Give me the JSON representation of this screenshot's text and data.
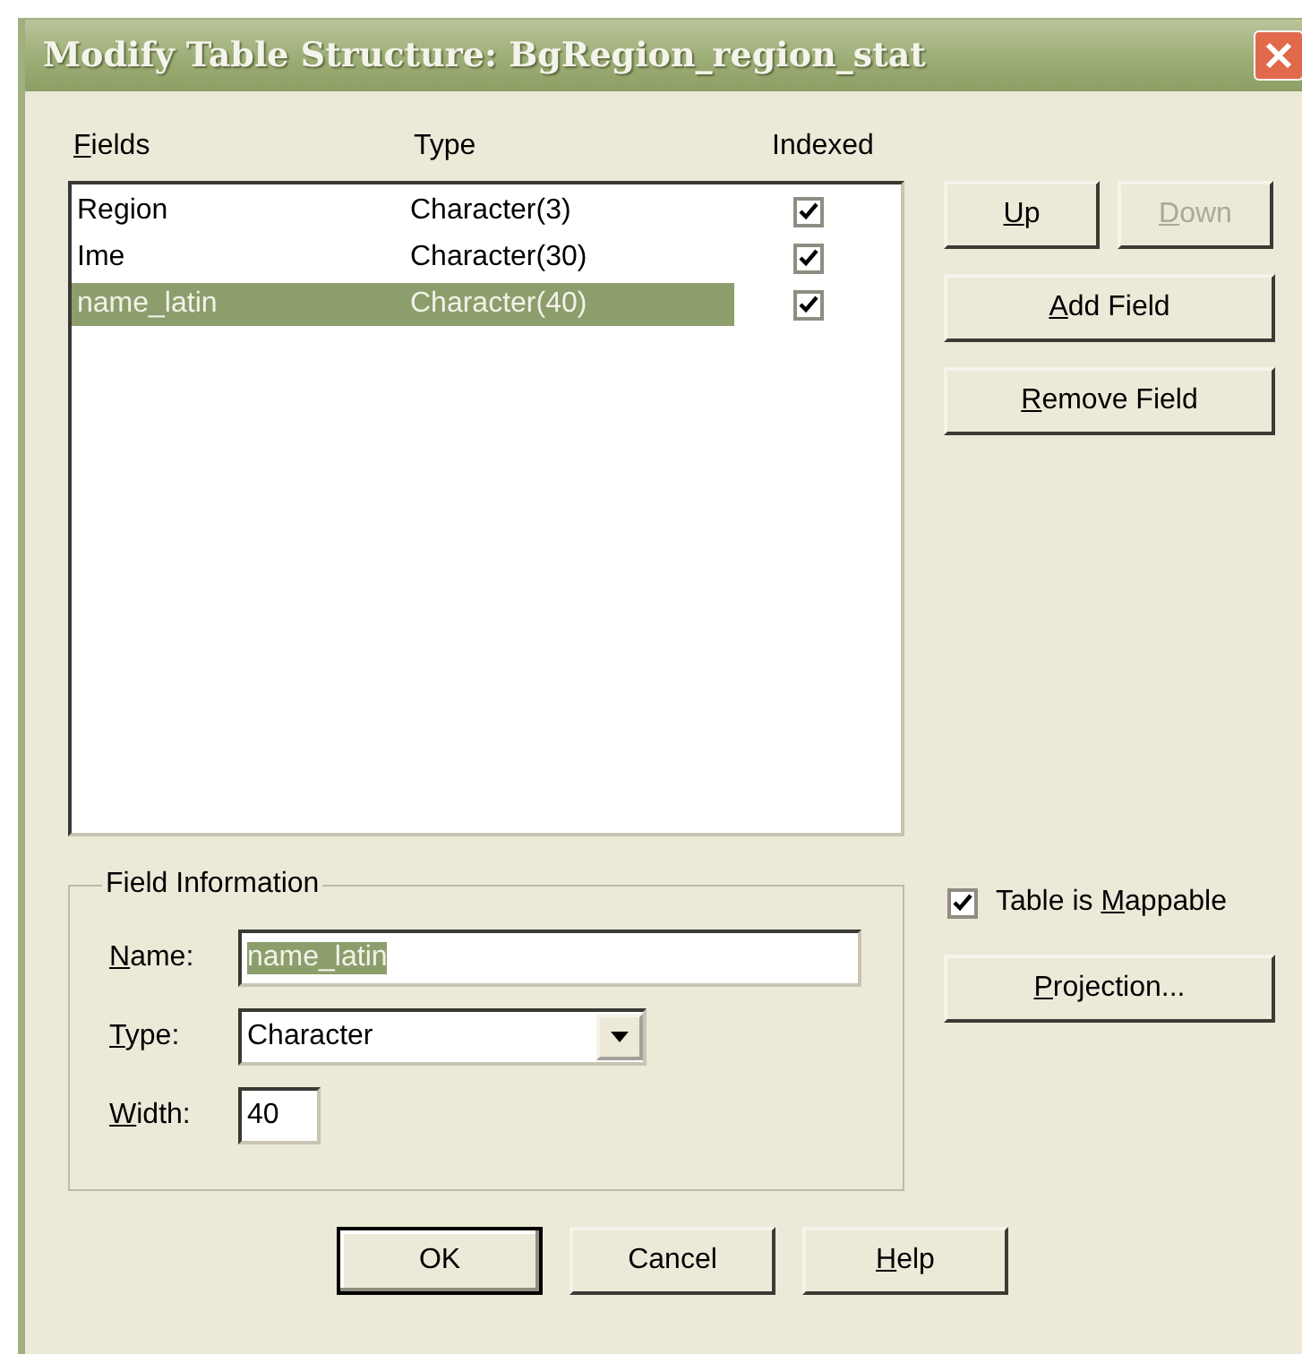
{
  "window": {
    "title": "Modify Table Structure: BgRegion_region_stat"
  },
  "columns": [
    {
      "key": "F",
      "post": "ields"
    },
    {
      "pre": "Type"
    },
    {
      "pre": "Indexed"
    }
  ],
  "fields": [
    {
      "name": "Region",
      "type": "Character(3)",
      "indexed": true,
      "selected": false
    },
    {
      "name": "Ime",
      "type": "Character(30)",
      "indexed": true,
      "selected": false
    },
    {
      "name": "name_latin",
      "type": "Character(40)",
      "indexed": true,
      "selected": true
    }
  ],
  "side_buttons": [
    {
      "kind": "half",
      "key": "U",
      "post": "p",
      "disabled": false
    },
    {
      "kind": "half",
      "key": "D",
      "post": "own",
      "disabled": true
    },
    {
      "kind": "full",
      "key": "A",
      "post": "dd Field",
      "disabled": false
    },
    {
      "kind": "full",
      "key": "R",
      "post": "emove Field",
      "disabled": false
    }
  ],
  "field_information": {
    "title": "Field Information",
    "name": {
      "label": {
        "key": "N",
        "post": "ame:"
      },
      "value": "name_latin"
    },
    "type": {
      "label": {
        "key": "T",
        "post": "ype:"
      },
      "value": "Character"
    },
    "width": {
      "label": {
        "key": "W",
        "post": "idth:"
      },
      "value": "40"
    }
  },
  "mappable": {
    "pre": "Table is ",
    "key": "M",
    "post": "appable",
    "checked": true
  },
  "projection_button": {
    "key": "P",
    "post": "rojection..."
  },
  "buttons": [
    {
      "pre": "OK",
      "default": true
    },
    {
      "pre": "Cancel",
      "default": false
    },
    {
      "key": "H",
      "post": "elp",
      "default": false
    }
  ]
}
